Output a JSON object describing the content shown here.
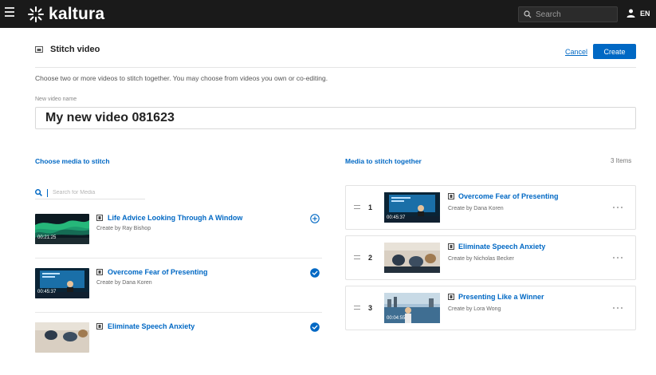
{
  "header": {
    "logo_text": "kaltura",
    "search_placeholder": "Search",
    "language": "EN",
    "background": "#1a1a1a"
  },
  "page": {
    "title": "Stitch video",
    "cancel_label": "Cancel",
    "create_label": "Create",
    "instructions": "Choose two or more videos to stitch together. You may choose from videos you own or co-editing.",
    "name_label": "New video name",
    "name_value": "My new video 081623",
    "accent": "#0068c4"
  },
  "left_panel": {
    "title": "Choose media to stitch",
    "search_placeholder": "Search for Media",
    "items": [
      {
        "title": "Life Advice Looking Through A Window",
        "creator": "Create by Ray Bishop",
        "duration": "00:21:25",
        "selected": false,
        "icon": "add-circle-icon"
      },
      {
        "title": "Overcome Fear of Presenting",
        "creator": "Create by Dana Koren",
        "duration": "00:45:37",
        "selected": true,
        "icon": "check-circle-icon"
      },
      {
        "title": "Eliminate Speech Anxiety",
        "creator": "",
        "duration": "",
        "selected": true,
        "icon": "check-circle-icon"
      }
    ]
  },
  "right_panel": {
    "title": "Media to stitch together",
    "count": "3 Items",
    "items": [
      {
        "index": "1",
        "title": "Overcome Fear of Presenting",
        "creator": "Create by Dana Koren",
        "duration": "00:45:37"
      },
      {
        "index": "2",
        "title": "Eliminate Speech Anxiety",
        "creator": "Create by Nicholas Becker",
        "duration": ""
      },
      {
        "index": "3",
        "title": "Presenting Like a Winner",
        "creator": "Create by Lora Wong",
        "duration": "00:04:55"
      }
    ]
  }
}
